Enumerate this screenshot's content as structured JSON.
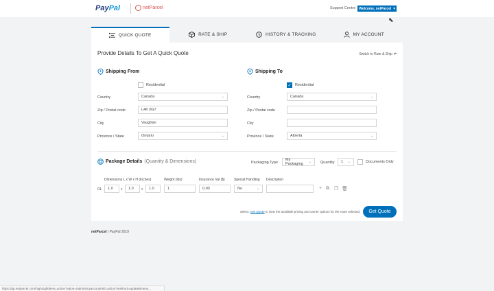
{
  "header": {
    "paypal_logo_a": "Pay",
    "paypal_logo_b": "Pal",
    "netparcel_logo": "netParcel",
    "support_link": "Support Centre",
    "welcome_button": "Welcome, netParcel"
  },
  "tabs": [
    {
      "label": "QUICK QUOTE",
      "icon": "list-icon",
      "active": true
    },
    {
      "label": "RATE & SHIP",
      "icon": "box-icon"
    },
    {
      "label": "HISTORY & TRACKING",
      "icon": "clock-icon"
    },
    {
      "label": "MY ACCOUNT",
      "icon": "user-icon"
    }
  ],
  "card": {
    "title": "Provide Details To Get A Quick Quote",
    "switch_link": "Switch to Rate & Ship"
  },
  "shipping_from": {
    "heading": "Shipping From",
    "residential_label": "Residential",
    "residential_checked": false,
    "country_label": "Country",
    "country_value": "Canada",
    "zip_label": "Zip / Postal code",
    "zip_value": "L4K 0G7",
    "city_label": "City",
    "city_value": "Vaughan",
    "province_label": "Province / State",
    "province_value": "Ontario"
  },
  "shipping_to": {
    "heading": "Shipping To",
    "residential_label": "Residential",
    "residential_checked": true,
    "country_label": "Country",
    "country_value": "Canada",
    "zip_label": "Zip / Postal code",
    "zip_value": "",
    "city_label": "City",
    "city_value": "",
    "province_label": "Province / State",
    "province_value": "Alberta"
  },
  "package": {
    "heading": "Package Details",
    "subheading": "(Quantity & Dimensions)",
    "packaging_type_label": "Packaging Type",
    "packaging_type_value": "My Packaging",
    "quantity_label": "Quantity",
    "quantity_value": "1",
    "documents_only_label": "Documents Only",
    "col_dimensions": "Dimensions L x W x H  (Inches)",
    "col_weight": "Weight (lbs)",
    "col_insurance": "Insurance Val ($)",
    "col_special": "Special Handling",
    "col_description": "Description",
    "row_index": "01.",
    "length": "1.0",
    "width": "1.0",
    "height": "1.0",
    "x_sep": "x",
    "weight": "1",
    "insurance": "0.00",
    "special_handling": "No",
    "description": ""
  },
  "footer_note": {
    "prefix": "Select",
    "link": "Get Quote",
    "suffix": "to view the available pricing and carrier options for the route selected"
  },
  "get_quote_button": "Get Quote",
  "footer": {
    "brand": "netParcel",
    "rest": " | PayPal 2019"
  },
  "status_url": "https://pp.netparcel.com/highLightMenu.action?value=/admin/myaccountInfo.action?method=updateBmenu...",
  "colors": {
    "accent": "#0070ba",
    "netparcel_red": "#d9534f"
  }
}
